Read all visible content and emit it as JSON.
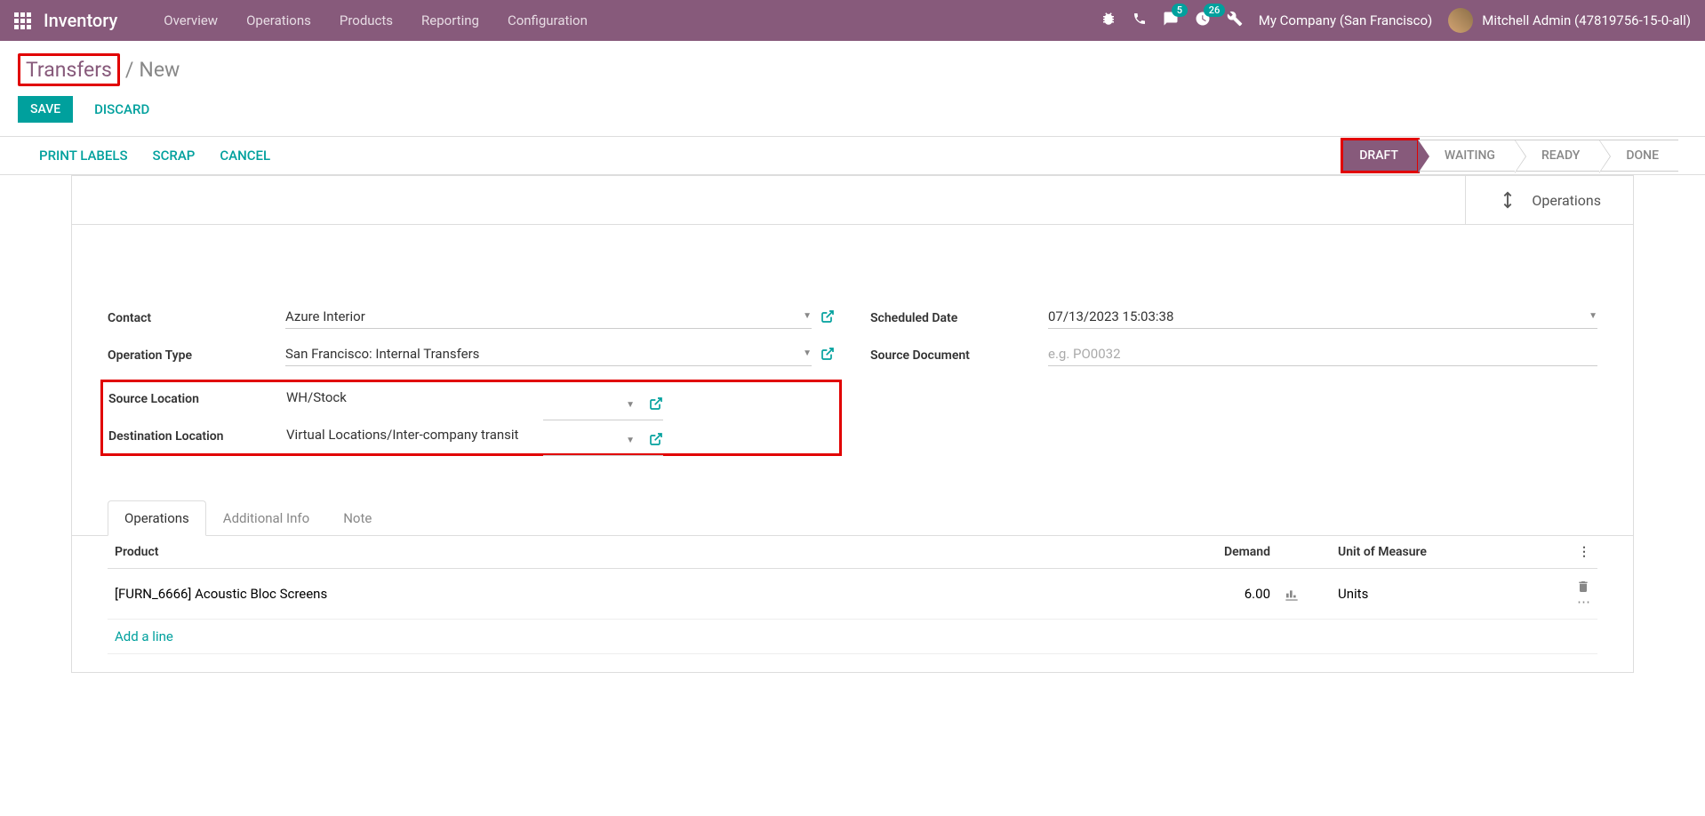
{
  "topnav": {
    "brand": "Inventory",
    "menu": [
      "Overview",
      "Operations",
      "Products",
      "Reporting",
      "Configuration"
    ],
    "badges": {
      "msg": "5",
      "activity": "26"
    },
    "company": "My Company (San Francisco)",
    "user": "Mitchell Admin (47819756-15-0-all)"
  },
  "breadcrumb": {
    "link": "Transfers",
    "current": "New"
  },
  "actions": {
    "save": "SAVE",
    "discard": "DISCARD"
  },
  "toolbar": {
    "print_labels": "PRINT LABELS",
    "scrap": "SCRAP",
    "cancel": "CANCEL"
  },
  "status": {
    "steps": [
      "DRAFT",
      "WAITING",
      "READY",
      "DONE"
    ],
    "active": 0
  },
  "stat": {
    "operations": "Operations"
  },
  "form": {
    "contact": {
      "label": "Contact",
      "value": "Azure Interior"
    },
    "operation_type": {
      "label": "Operation Type",
      "value": "San Francisco: Internal Transfers"
    },
    "source_location": {
      "label": "Source Location",
      "value": "WH/Stock"
    },
    "dest_location": {
      "label": "Destination Location",
      "value": "Virtual Locations/Inter-company transit"
    },
    "scheduled_date": {
      "label": "Scheduled Date",
      "value": "07/13/2023 15:03:38"
    },
    "source_doc": {
      "label": "Source Document",
      "placeholder": "e.g. PO0032"
    }
  },
  "tabs": [
    "Operations",
    "Additional Info",
    "Note"
  ],
  "table": {
    "headers": {
      "product": "Product",
      "demand": "Demand",
      "uom": "Unit of Measure"
    },
    "rows": [
      {
        "product": "[FURN_6666] Acoustic Bloc Screens",
        "demand": "6.00",
        "uom": "Units"
      }
    ],
    "add_line": "Add a line"
  }
}
